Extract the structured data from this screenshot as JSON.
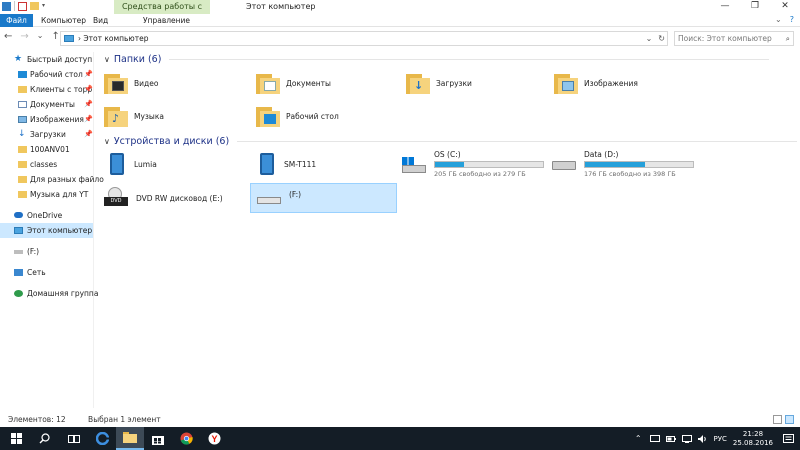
{
  "window": {
    "title": "Этот компьютер",
    "context_tab": "Средства работы с дисками",
    "controls": [
      "—",
      "❐",
      "✕"
    ]
  },
  "ribbon": {
    "tabs": [
      "Файл",
      "Компьютер",
      "Вид",
      "Управление"
    ],
    "right": [
      "⌄",
      "?"
    ]
  },
  "nav": {
    "back": "←",
    "forward": "→",
    "recent": "⌄",
    "up": "↑",
    "address": "› Этот компьютер",
    "address_dropdown": "⌄",
    "refresh": "↻",
    "search_placeholder": "Поиск: Этот компьютер",
    "search_icon": "⌕"
  },
  "sidebar": {
    "quick_access": "Быстрый доступ",
    "items": [
      {
        "label": "Рабочий стол",
        "pin": "📌",
        "icon": "desktop-icon"
      },
      {
        "label": "Клиенты с торр",
        "pin": "📌",
        "icon": "folder-icon"
      },
      {
        "label": "Документы",
        "pin": "📌",
        "icon": "documents-icon"
      },
      {
        "label": "Изображения",
        "pin": "📌",
        "icon": "pictures-icon"
      },
      {
        "label": "Загрузки",
        "pin": "📌",
        "icon": "downloads-icon"
      },
      {
        "label": "100ANV01",
        "pin": "",
        "icon": "folder-icon"
      },
      {
        "label": "classes",
        "pin": "",
        "icon": "folder-icon"
      },
      {
        "label": "Для разных файло",
        "pin": "",
        "icon": "folder-icon"
      },
      {
        "label": "Музыка для YT",
        "pin": "",
        "icon": "folder-icon"
      }
    ],
    "onedrive": "OneDrive",
    "this_pc": "Этот компьютер",
    "drive_f": "(F:)",
    "network": "Сеть",
    "homegroup": "Домашняя группа"
  },
  "main": {
    "folders_header": "Папки (6)",
    "folders": [
      {
        "label": "Видео",
        "icon": "video-folder-icon"
      },
      {
        "label": "Документы",
        "icon": "documents-folder-icon"
      },
      {
        "label": "Загрузки",
        "icon": "downloads-folder-icon"
      },
      {
        "label": "Изображения",
        "icon": "pictures-folder-icon"
      },
      {
        "label": "Музыка",
        "icon": "music-folder-icon"
      },
      {
        "label": "Рабочий стол",
        "icon": "desktop-folder-icon"
      }
    ],
    "devices_header": "Устройства и диски (6)",
    "devices": [
      {
        "label": "Lumia",
        "icon": "phone-icon"
      },
      {
        "label": "SM-T111",
        "icon": "tablet-icon"
      },
      {
        "label": "OS (C:)",
        "free": "205 ГБ свободно из 279 ГБ",
        "used_fraction": 0.27,
        "icon": "windows-drive-icon"
      },
      {
        "label": "Data (D:)",
        "free": "176 ГБ свободно из 398 ГБ",
        "used_fraction": 0.56,
        "icon": "hard-drive-icon"
      },
      {
        "label": "DVD RW дисковод (E:)",
        "icon": "dvd-drive-icon"
      },
      {
        "label": "(F:)",
        "icon": "removable-drive-icon"
      }
    ]
  },
  "status": {
    "items": "Элементов: 12",
    "selected": "Выбран 1 элемент"
  },
  "taskbar": {
    "time": "21:28",
    "date": "25.08.2016",
    "lang": "РУС",
    "tray_chevron": "⌃"
  },
  "colors": {
    "accent": "#1979ca",
    "selection": "#cce8ff",
    "drive_bar": "#26a0da",
    "taskbar": "#141d26"
  }
}
